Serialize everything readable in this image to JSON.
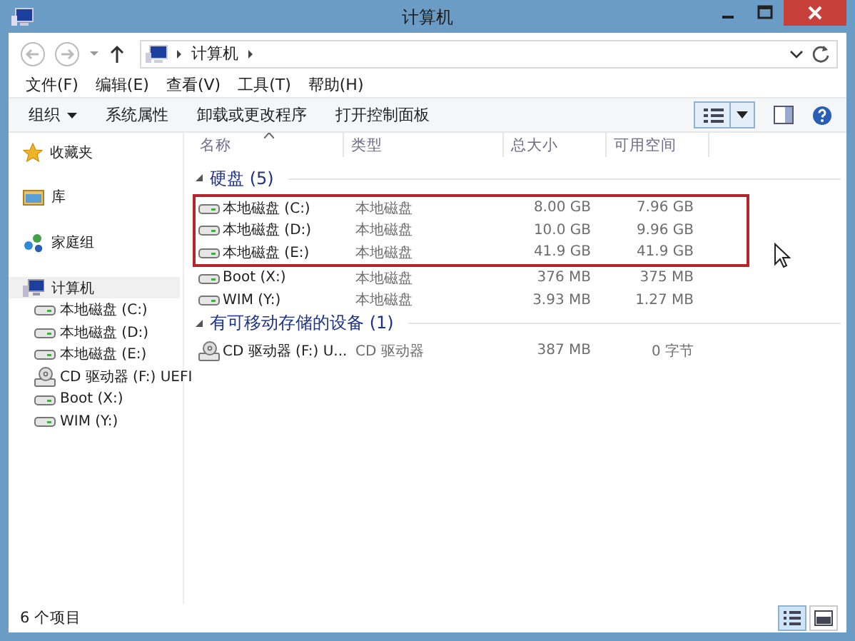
{
  "window": {
    "title": "计算机"
  },
  "nav": {
    "back_disabled": true,
    "forward_disabled": true
  },
  "address": {
    "path": [
      "计算机"
    ]
  },
  "menu": [
    {
      "label": "文件(F)"
    },
    {
      "label": "编辑(E)"
    },
    {
      "label": "查看(V)"
    },
    {
      "label": "工具(T)"
    },
    {
      "label": "帮助(H)"
    }
  ],
  "toolbar": {
    "commands": [
      {
        "label": "组织",
        "dropdown": true
      },
      {
        "label": "系统属性",
        "dropdown": false
      },
      {
        "label": "卸载或更改程序",
        "dropdown": false
      },
      {
        "label": "打开控制面板",
        "dropdown": false
      }
    ]
  },
  "sidebar": {
    "items": [
      {
        "label": "收藏夹",
        "kind": "favorites",
        "selected": false
      },
      {
        "label": "库",
        "kind": "library",
        "selected": false
      },
      {
        "label": "家庭组",
        "kind": "homegroup",
        "selected": false
      },
      {
        "label": "计算机",
        "kind": "computer",
        "selected": true,
        "children": [
          {
            "label": "本地磁盘 (C:)",
            "kind": "disk",
            "selected": false
          },
          {
            "label": "本地磁盘 (D:)",
            "kind": "disk",
            "selected": false
          },
          {
            "label": "本地磁盘 (E:)",
            "kind": "disk",
            "selected": false
          },
          {
            "label": "CD 驱动器 (F:) UEFI",
            "kind": "cd",
            "selected": false
          },
          {
            "label": "Boot (X:)",
            "kind": "disk",
            "selected": false
          },
          {
            "label": "WIM (Y:)",
            "kind": "disk",
            "selected": false
          }
        ]
      }
    ]
  },
  "table": {
    "columns": [
      "名称",
      "类型",
      "总大小",
      "可用空间"
    ],
    "groups": [
      {
        "title": "硬盘 (5)",
        "expanded": true,
        "rows": [
          {
            "name": "本地磁盘 (C:)",
            "kind": "disk",
            "type": "本地磁盘",
            "total": "8.00 GB",
            "free": "7.96 GB",
            "highlighted": true
          },
          {
            "name": "本地磁盘 (D:)",
            "kind": "disk",
            "type": "本地磁盘",
            "total": "10.0 GB",
            "free": "9.96 GB",
            "highlighted": true
          },
          {
            "name": "本地磁盘 (E:)",
            "kind": "disk",
            "type": "本地磁盘",
            "total": "41.9 GB",
            "free": "41.9 GB",
            "highlighted": true
          },
          {
            "name": "Boot (X:)",
            "kind": "disk",
            "type": "本地磁盘",
            "total": "376 MB",
            "free": "375 MB",
            "highlighted": false
          },
          {
            "name": "WIM (Y:)",
            "kind": "disk",
            "type": "本地磁盘",
            "total": "3.93 MB",
            "free": "1.27 MB",
            "highlighted": false
          }
        ]
      },
      {
        "title": "有可移动存储的设备 (1)",
        "expanded": true,
        "rows": [
          {
            "name": "CD 驱动器 (F:) U...",
            "kind": "cd",
            "type": "CD 驱动器",
            "total": "387 MB",
            "free": "0 字节",
            "highlighted": false
          }
        ]
      }
    ]
  },
  "status_bar": {
    "text": "6 个项目",
    "views": [
      {
        "kind": "details",
        "selected": true
      },
      {
        "kind": "large_icons",
        "selected": false
      }
    ]
  }
}
